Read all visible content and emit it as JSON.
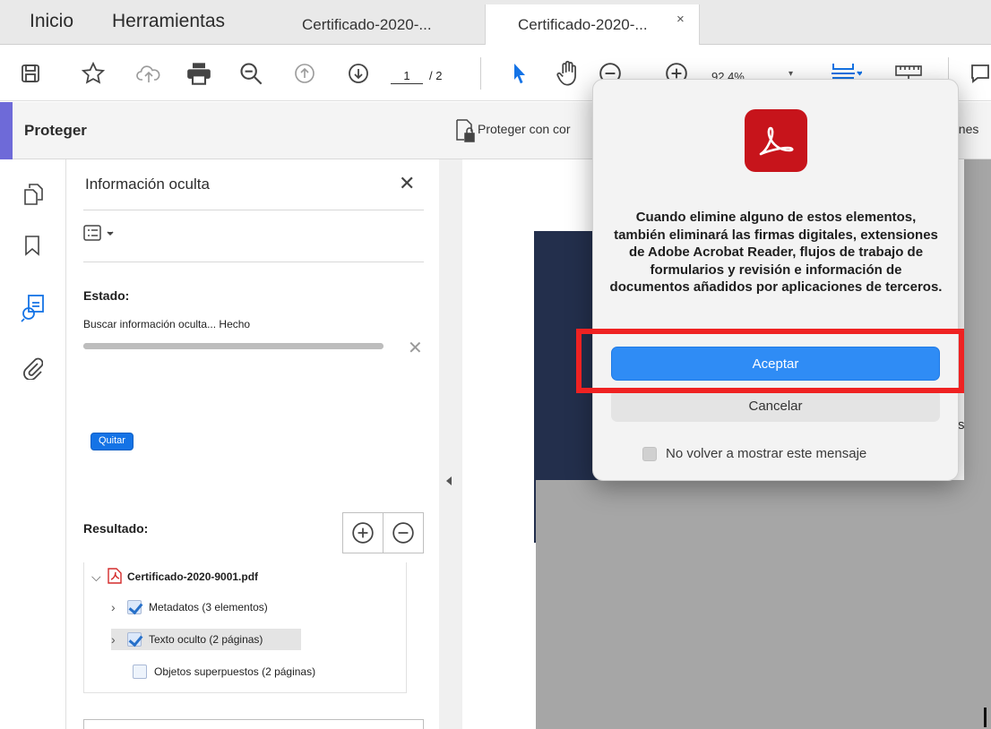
{
  "tabs": {
    "home": "Inicio",
    "tools": "Herramientas",
    "doc1": "Certificado-2020-...",
    "doc2": "Certificado-2020-...",
    "close": "×"
  },
  "toolbar": {
    "page_current": "1",
    "page_total": "/ 2",
    "zoom": "92,4%",
    "zoom_caret": "▾",
    "icons": [
      "save-icon",
      "bookmark-star-icon",
      "upload-cloud-icon",
      "print-icon",
      "zoom-out-magnifier-icon",
      "page-up-icon",
      "page-down-icon",
      "select-arrow-icon",
      "hand-icon",
      "zoom-out-icon",
      "zoom-in-icon",
      "fit-page-icon",
      "ruler-icon",
      "comment-icon"
    ]
  },
  "protect": {
    "title": "Proteger",
    "tool_protect": "Proteger con cor",
    "tool_right": "ones"
  },
  "panel": {
    "title": "Información oculta",
    "close": "✕",
    "status_label": "Estado:",
    "status_text": "Buscar información oculta... Hecho",
    "progress": 1.0,
    "progress_cancel": "✕",
    "remove_button": "Quitar",
    "result_label": "Resultado:",
    "tree": {
      "file": "Certificado-2020-9001.pdf",
      "items": [
        {
          "label": "Metadatos (3 elementos)",
          "checked": true,
          "expandable": true
        },
        {
          "label": "Texto oculto (2 páginas)",
          "checked": true,
          "expandable": true,
          "selected": true
        },
        {
          "label": "Objetos superpuestos (2 páginas)",
          "checked": false,
          "expandable": false
        }
      ]
    }
  },
  "dialog": {
    "message": "Cuando elimine alguno de estos elementos, también eliminará las firmas digitales, extensiones de Adobe Acrobat Reader, flujos de trabajo de formularios y revisión e información de documentos añadidos por aplicaciones de terceros.",
    "accept": "Aceptar",
    "cancel": "Cancelar",
    "dont_show": "No volver a mostrar este mensaje",
    "dont_show_checked": false
  },
  "document": {
    "visible_char": "s"
  },
  "colors": {
    "accent_blue": "#2f8cf5",
    "adobe_red": "#c7141b",
    "highlight_red": "#ef2222",
    "protect_accent": "#6e6ad8"
  }
}
